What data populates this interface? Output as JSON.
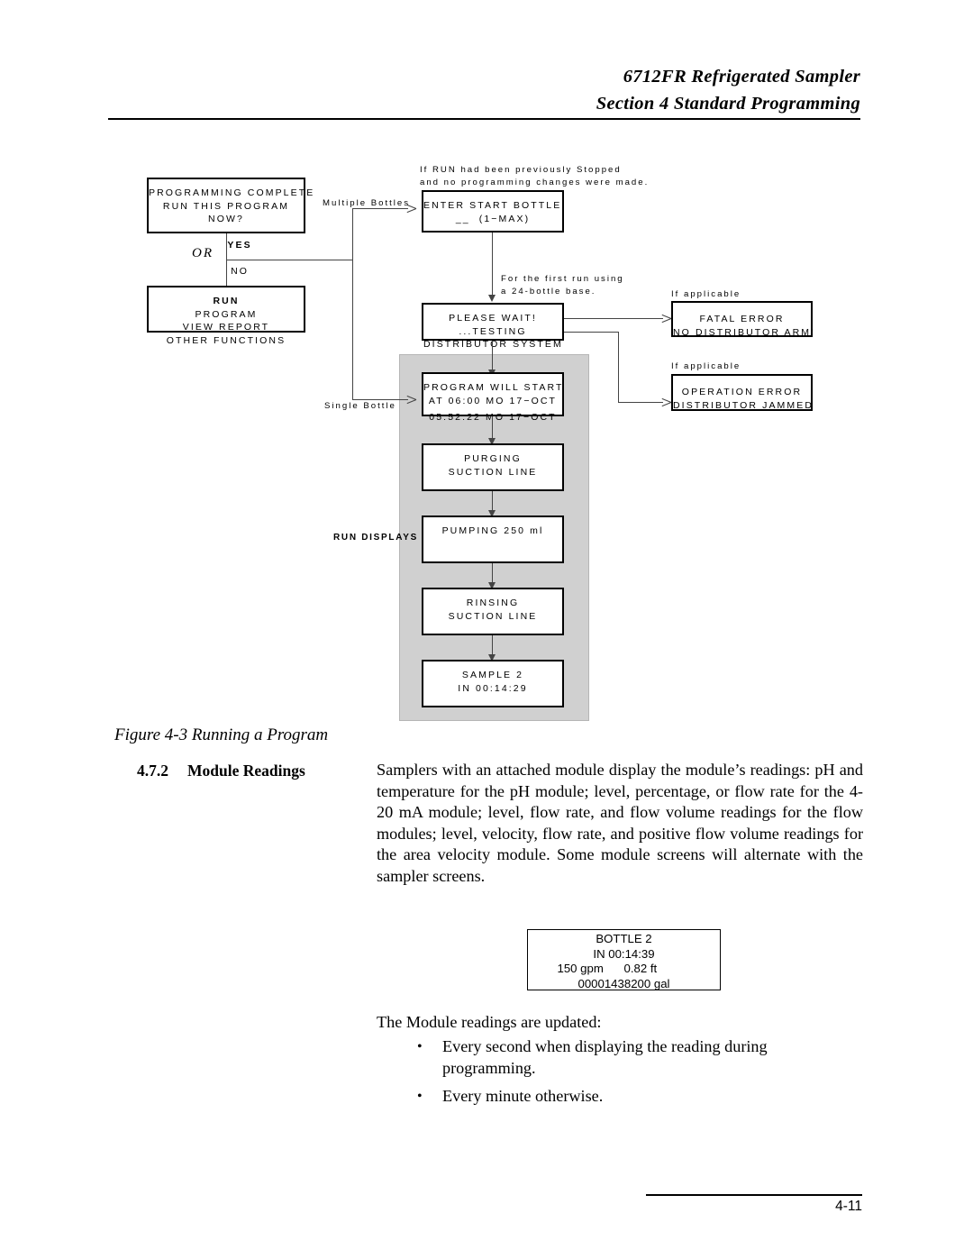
{
  "header": {
    "title": "6712FR Refrigerated Sampler",
    "section": "Section 4   Standard Programming"
  },
  "figure": {
    "caption": "Figure 4-3  Running a Program",
    "run_displays_label": "RUN DISPLAYS",
    "or_label": "OR",
    "boxes": {
      "programming_complete": {
        "line1": "PROGRAMMING COMPLETE",
        "line2": "RUN THIS PROGRAM",
        "line3": "NOW?",
        "line4_yes": "YES",
        "line4_no": "NO"
      },
      "run_menu": {
        "line1": "RUN",
        "line2": "PROGRAM",
        "line3": "VIEW REPORT",
        "line4": "OTHER FUNCTIONS"
      },
      "enter_start_bottle": {
        "line1": "ENTER START BOTTLE:",
        "line2": "__  (1−MAX)"
      },
      "please_wait": {
        "line1": "PLEASE WAIT!",
        "line2": "...TESTING",
        "line3": "DISTRIBUTOR SYSTEM"
      },
      "fatal_error": {
        "line1": "FATAL ERROR",
        "line2": "NO DISTRIBUTOR ARM!"
      },
      "operation_error": {
        "line1": "OPERATION ERROR",
        "line2": "DISTRIBUTOR JAMMED"
      },
      "program_will_start": {
        "line1": "PROGRAM WILL START",
        "line2": "AT 06:00 MO 17−OCT",
        "line3": "05:52:22 MO 17−OCT"
      },
      "purging": {
        "line1": "PURGING",
        "line2": "SUCTION LINE"
      },
      "pumping": {
        "line1": "PUMPING 250 ml"
      },
      "rinsing": {
        "line1": "RINSING",
        "line2": "SUCTION LINE"
      },
      "sample": {
        "line1": "SAMPLE 2",
        "line2": "IN 00:14:29"
      }
    },
    "notes": {
      "if_run_stopped_l1": "If RUN had been previously Stopped",
      "if_run_stopped_l2": "and no programming changes were made.",
      "multiple_bottles": "Multiple Bottles",
      "single_bottle": "Single Bottle",
      "first_run_l1": "For the first run using",
      "first_run_l2": "a 24-bottle base.",
      "if_applicable_1": "If applicable",
      "if_applicable_2": "If applicable"
    }
  },
  "section": {
    "number": "4.7.2",
    "title": "Module Readings",
    "paragraph": "Samplers with an attached module display the module’s readings: pH and temperature for the pH module; level, percentage, or flow rate for the 4-20 mA module; level, flow rate, and flow volume readings for the flow modules; level, velocity, flow rate, and positive flow volume readings for the area velocity module. Some module screens will alternate with the sampler screens.",
    "updated_intro": "The Module readings are updated:",
    "bullets": [
      "Every second when displaying the reading during programming.",
      "Every minute otherwise."
    ]
  },
  "lcd_display": {
    "bottle": "BOTTLE 2",
    "time": "IN 00:14:39",
    "flow_rate": "150 gpm",
    "level": "0.82 ft",
    "total": "00001438200 gal"
  },
  "footer": {
    "page": "4-11"
  }
}
